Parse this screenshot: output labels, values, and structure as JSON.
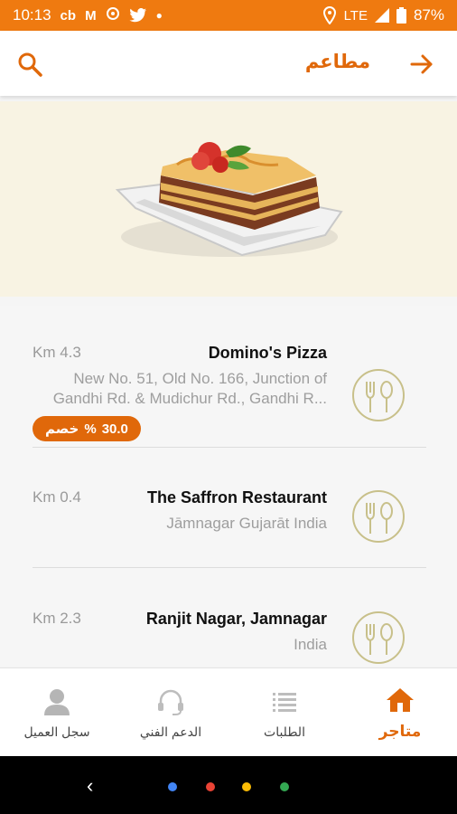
{
  "status_bar": {
    "time": "10:13",
    "icons": [
      "cb",
      "M"
    ],
    "network": "LTE",
    "battery": "87%",
    "colors": {
      "background": "#ef7a10"
    }
  },
  "app_bar": {
    "title": "مطاعم"
  },
  "restaurants": [
    {
      "name": "Domino's Pizza",
      "distance": "Km 4.3",
      "address": "New No. 51, Old No. 166, Junction of Gandhi Rd. & Mudichur Rd., Gandhi R...",
      "discount": {
        "value": "30.0",
        "percent": "%",
        "label": "خصم"
      }
    },
    {
      "name": "The Saffron Restaurant",
      "distance": "Km 0.4",
      "address": "Jāmnagar Gujarāt India"
    },
    {
      "name": "Ranjit Nagar, Jamnagar",
      "distance": "Km 2.3",
      "address": "India"
    }
  ],
  "bottom_nav": {
    "stores": "متاجر",
    "orders": "الطلبات",
    "support": "الدعم الفني",
    "account": "سجل العميل"
  },
  "colors": {
    "accent": "#e0680a",
    "hero_bg": "#f8f3e3",
    "logo": "#c8c08a"
  }
}
